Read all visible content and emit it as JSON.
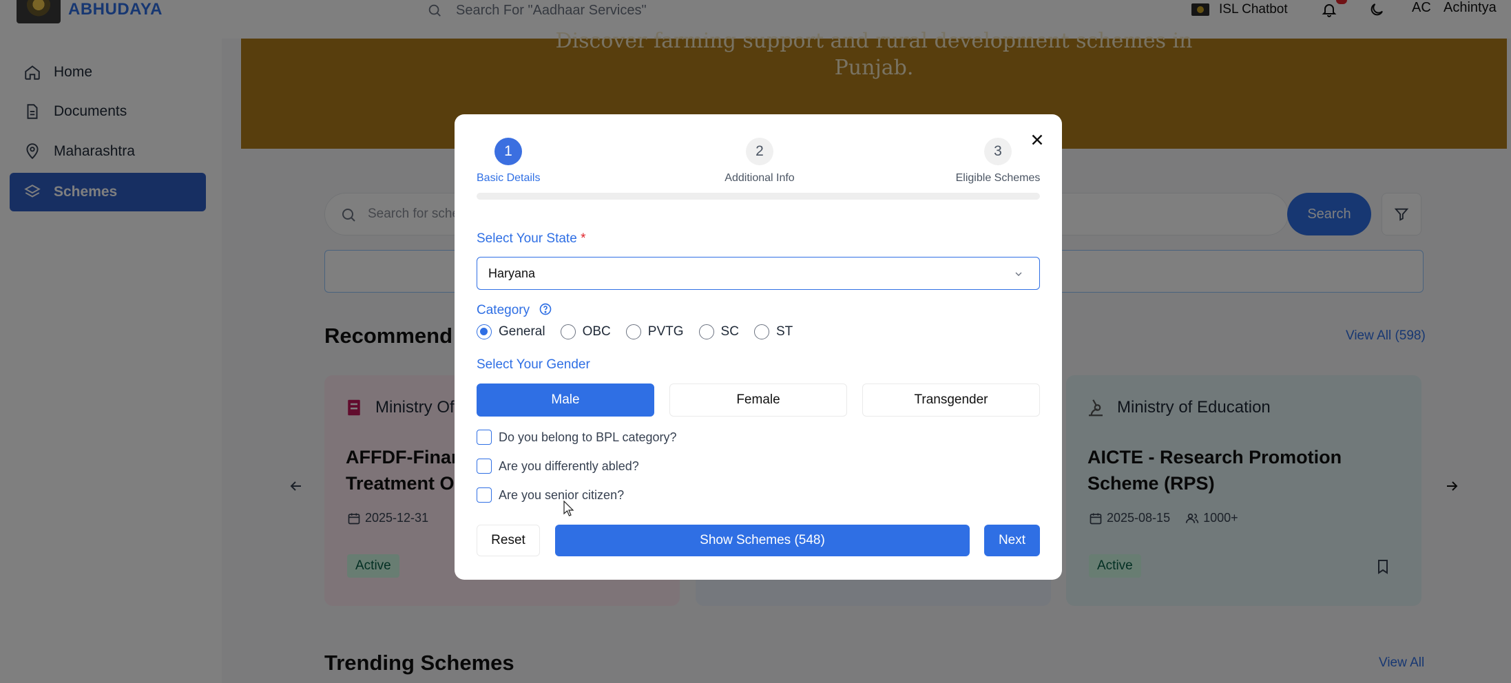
{
  "app": {
    "brand": "ABHUDAYA",
    "search_placeholder": "Search For \"Aadhaar Services\"",
    "isl_chatbot": "ISL Chatbot",
    "user_initials": "AC",
    "user_name": "Achintya"
  },
  "sidebar": {
    "items": [
      {
        "label": "Home",
        "icon": "home-icon"
      },
      {
        "label": "Documents",
        "icon": "document-icon"
      },
      {
        "label": "Maharashtra",
        "icon": "location-pin-icon"
      },
      {
        "label": "Schemes",
        "icon": "layers-icon",
        "active": true
      }
    ]
  },
  "banner": {
    "line1": "Discover farming support and rural development schemes in",
    "line2": "Punjab."
  },
  "main": {
    "search_placeholder": "Search for sche",
    "search_button": "Search",
    "recommended_title": "Recommend",
    "recommended_view_all": "View All (598)",
    "trending_title": "Trending Schemes",
    "trending_view_all": "View All",
    "cards": [
      {
        "ministry": "Ministry Of",
        "title_line1": "AFFDF-Finar",
        "title_line2": "Treatment Of",
        "date": "2025-12-31",
        "status": "Active"
      },
      {
        "ministry": "Ministry of Education",
        "title_line1": "AICTE - Research Promotion",
        "title_line2": "Scheme (RPS)",
        "date": "2025-08-15",
        "beneficiaries": "1000+",
        "status": "Active"
      }
    ]
  },
  "modal": {
    "steps": [
      {
        "number": "1",
        "label": "Basic Details",
        "active": true
      },
      {
        "number": "2",
        "label": "Additional Info"
      },
      {
        "number": "3",
        "label": "Eligible Schemes"
      }
    ],
    "state_label": "Select Your State",
    "required_mark": "*",
    "state_value": "Haryana",
    "category_label": "Category",
    "categories": [
      "General",
      "OBC",
      "PVTG",
      "SC",
      "ST"
    ],
    "selected_category": "General",
    "gender_label": "Select Your Gender",
    "genders": [
      "Male",
      "Female",
      "Transgender"
    ],
    "selected_gender": "Male",
    "checkboxes": [
      "Do you belong to BPL category?",
      "Are you differently abled?",
      "Are you senior citizen?"
    ],
    "reset_label": "Reset",
    "show_label": "Show Schemes (548)",
    "next_label": "Next"
  },
  "colors": {
    "accent": "#2f6fe4",
    "banner": "#b07c1a",
    "status_bg": "#d1fae5"
  }
}
